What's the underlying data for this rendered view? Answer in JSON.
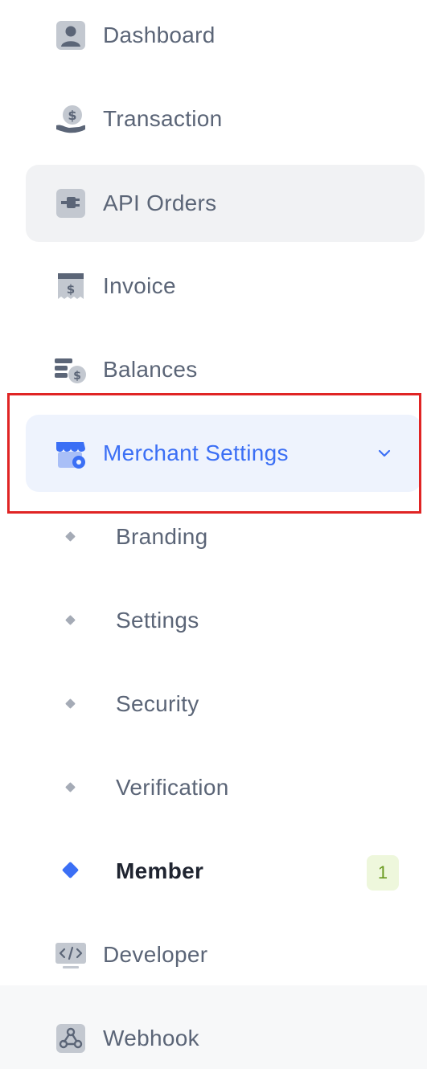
{
  "nav": {
    "dashboard": "Dashboard",
    "transaction": "Transaction",
    "api_orders": "API Orders",
    "invoice": "Invoice",
    "balances": "Balances",
    "merchant_settings": "Merchant Settings",
    "developer": "Developer",
    "webhook": "Webhook"
  },
  "merchant_sub": {
    "branding": "Branding",
    "settings": "Settings",
    "security": "Security",
    "verification": "Verification",
    "member": "Member",
    "member_badge": "1"
  },
  "colors": {
    "accent": "#3b6ff5",
    "text": "#5b6577",
    "active_bg": "#eef3fd",
    "highlight": "#e02424",
    "badge_bg": "#eef7dc",
    "badge_text": "#6a9a1f"
  },
  "icons": {
    "dashboard": "user-icon",
    "transaction": "hand-dollar-icon",
    "api_orders": "plug-icon",
    "invoice": "receipt-icon",
    "balances": "balance-coins-icon",
    "merchant_settings": "store-settings-icon",
    "developer": "code-icon",
    "webhook": "webhook-icon"
  }
}
